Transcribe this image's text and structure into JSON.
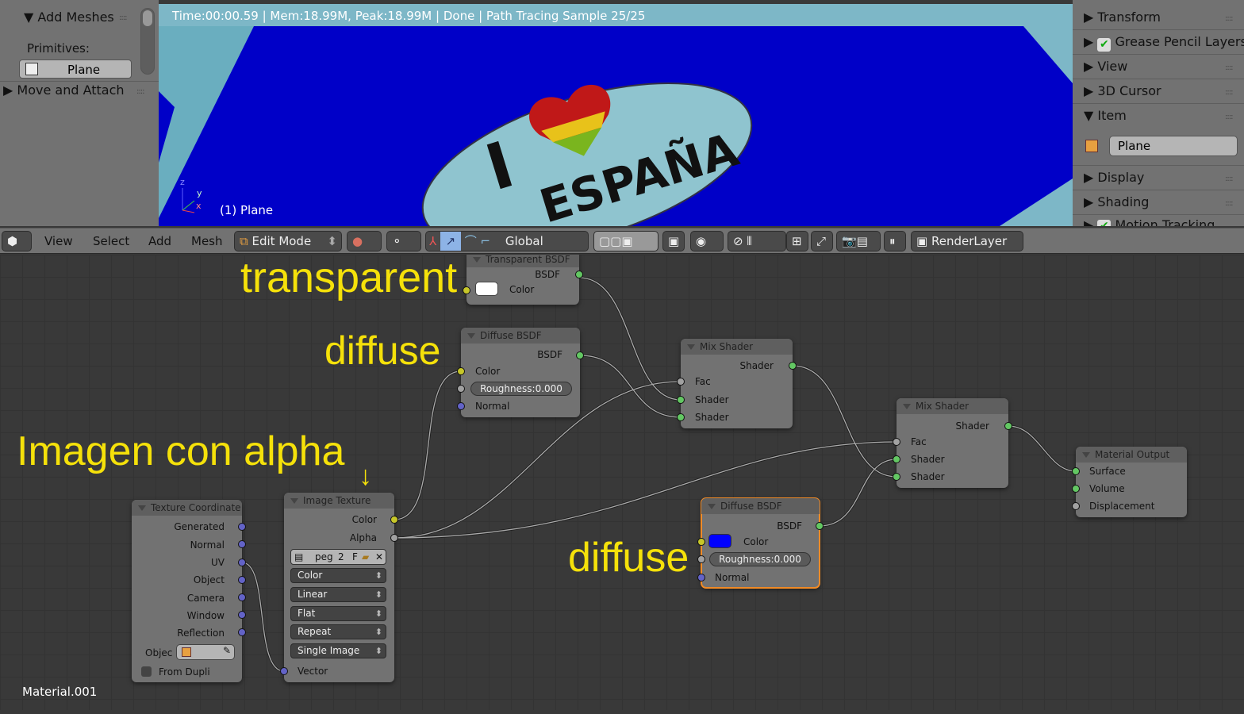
{
  "left_panel": {
    "add_meshes": "Add Meshes",
    "primitives_label": "Primitives:",
    "plane_button": "Plane",
    "move_attach": "Move and Attach"
  },
  "viewport": {
    "status": "Time:00:00.59 | Mem:18.99M, Peak:18.99M | Done | Path Tracing Sample 25/25",
    "object_label": "(1) Plane",
    "sticker_text_i": "I",
    "sticker_text_espana": "ESPAÑA",
    "axis_z": "z",
    "axis_y": "y",
    "axis_x": "x"
  },
  "right_panel": {
    "items": [
      {
        "label": "Transform",
        "open": false
      },
      {
        "label": "Grease Pencil Layers",
        "open": false,
        "checkbox": true
      },
      {
        "label": "View",
        "open": false
      },
      {
        "label": "3D Cursor",
        "open": false
      },
      {
        "label": "Item",
        "open": true
      },
      {
        "label": "Display",
        "open": false
      },
      {
        "label": "Shading",
        "open": false
      },
      {
        "label": "Motion Tracking",
        "open": false,
        "checkbox": true
      }
    ],
    "item_name": "Plane"
  },
  "header": {
    "menus": [
      "View",
      "Select",
      "Add",
      "Mesh"
    ],
    "mode": "Edit Mode",
    "orientation": "Global",
    "render_layer": "RenderLayer"
  },
  "annotations": {
    "transparent": "transparent",
    "diffuse1": "diffuse",
    "imagen": "Imagen con alpha",
    "diffuse2": "diffuse",
    "arrow": "↓"
  },
  "nodes": {
    "transparent": {
      "title": "Transparent BSDF",
      "out": "BSDF",
      "color": "Color"
    },
    "diffuse1": {
      "title": "Diffuse BSDF",
      "out": "BSDF",
      "color": "Color",
      "roughness": "Roughness:",
      "roughness_value": "0.000",
      "normal": "Normal"
    },
    "mix1": {
      "title": "Mix Shader",
      "out": "Shader",
      "fac": "Fac",
      "s1": "Shader",
      "s2": "Shader"
    },
    "mix2": {
      "title": "Mix Shader",
      "out": "Shader",
      "fac": "Fac",
      "s1": "Shader",
      "s2": "Shader"
    },
    "output": {
      "title": "Material Output",
      "surface": "Surface",
      "volume": "Volume",
      "displacement": "Displacement"
    },
    "diffuse2": {
      "title": "Diffuse BSDF",
      "out": "BSDF",
      "color": "Color",
      "roughness": "Roughness:",
      "roughness_value": "0.000",
      "normal": "Normal",
      "swatch": "#0000ff"
    },
    "texcoord": {
      "title": "Texture Coordinate",
      "outputs": [
        "Generated",
        "Normal",
        "UV",
        "Object",
        "Camera",
        "Window",
        "Reflection"
      ],
      "object_label": "Objec",
      "from_dupli": "From Dupli"
    },
    "image": {
      "title": "Image Texture",
      "color": "Color",
      "alpha": "Alpha",
      "image_name": "peg",
      "users": "2",
      "fake": "F",
      "color_space": "Color",
      "interpolation": "Linear",
      "projection": "Flat",
      "extension": "Repeat",
      "source": "Single Image",
      "vector": "Vector"
    }
  },
  "material_name": "Material.001"
}
